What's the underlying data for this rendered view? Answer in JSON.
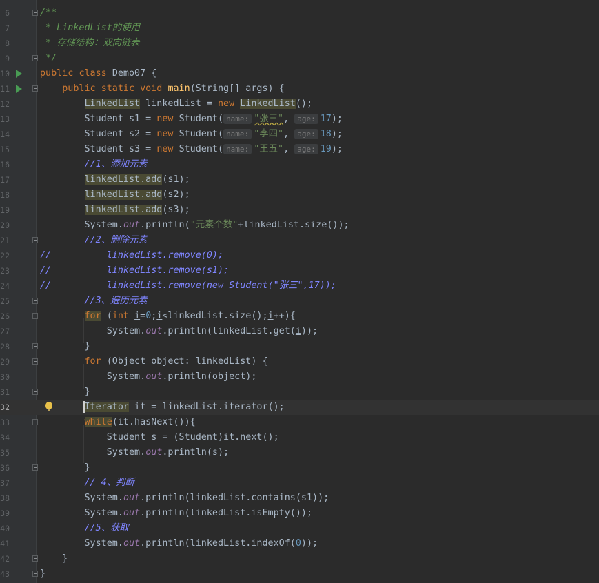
{
  "editor": {
    "lines": [
      {
        "n": "6",
        "segs": [
          {
            "t": "/**",
            "c": "cm"
          }
        ]
      },
      {
        "n": "7",
        "segs": [
          {
            "t": " * LinkedList的使用",
            "c": "cm"
          }
        ]
      },
      {
        "n": "8",
        "segs": [
          {
            "t": " * 存储结构：双向链表",
            "c": "cm"
          }
        ]
      },
      {
        "n": "9",
        "segs": [
          {
            "t": " */",
            "c": "cm"
          }
        ]
      },
      {
        "n": "10",
        "segs": [
          {
            "t": "public ",
            "c": "kw"
          },
          {
            "t": "class ",
            "c": "kw"
          },
          {
            "t": "Demo07 {"
          }
        ]
      },
      {
        "n": "11",
        "segs": [
          {
            "t": "    "
          },
          {
            "t": "public ",
            "c": "kw"
          },
          {
            "t": "static ",
            "c": "kw"
          },
          {
            "t": "void ",
            "c": "kw"
          },
          {
            "t": "main",
            "c": "fn"
          },
          {
            "t": "(String[] args) {"
          }
        ]
      },
      {
        "n": "12",
        "segs": [
          {
            "t": "        "
          },
          {
            "t": "LinkedList",
            "c": "hl"
          },
          {
            "t": " linkedList = "
          },
          {
            "t": "new ",
            "c": "kw"
          },
          {
            "t": "LinkedList",
            "c": "hl"
          },
          {
            "t": "();"
          }
        ]
      },
      {
        "n": "13",
        "segs": [
          {
            "t": "        Student s1 = "
          },
          {
            "t": "new ",
            "c": "kw"
          },
          {
            "t": "Student("
          },
          {
            "t": "name:",
            "c": "hint"
          },
          {
            "t": "\"张三\"",
            "c": "str squig"
          },
          {
            "t": ", "
          },
          {
            "t": "age:",
            "c": "hint"
          },
          {
            "t": "17",
            "c": "num"
          },
          {
            "t": ");"
          }
        ]
      },
      {
        "n": "14",
        "segs": [
          {
            "t": "        Student s2 = "
          },
          {
            "t": "new ",
            "c": "kw"
          },
          {
            "t": "Student("
          },
          {
            "t": "name:",
            "c": "hint"
          },
          {
            "t": "\"李四\"",
            "c": "str"
          },
          {
            "t": ", "
          },
          {
            "t": "age:",
            "c": "hint"
          },
          {
            "t": "18",
            "c": "num"
          },
          {
            "t": ");"
          }
        ]
      },
      {
        "n": "15",
        "segs": [
          {
            "t": "        Student s3 = "
          },
          {
            "t": "new ",
            "c": "kw"
          },
          {
            "t": "Student("
          },
          {
            "t": "name:",
            "c": "hint"
          },
          {
            "t": "\"王五\"",
            "c": "str"
          },
          {
            "t": ", "
          },
          {
            "t": "age:",
            "c": "hint"
          },
          {
            "t": "19",
            "c": "num"
          },
          {
            "t": ");"
          }
        ]
      },
      {
        "n": "16",
        "segs": [
          {
            "t": "        "
          },
          {
            "t": "//1、添加元素",
            "c": "cmb"
          }
        ]
      },
      {
        "n": "17",
        "segs": [
          {
            "t": "        "
          },
          {
            "t": "linkedList.add",
            "c": "hl"
          },
          {
            "t": "(s1);"
          }
        ]
      },
      {
        "n": "18",
        "segs": [
          {
            "t": "        "
          },
          {
            "t": "linkedList.add",
            "c": "hl"
          },
          {
            "t": "(s2);"
          }
        ]
      },
      {
        "n": "19",
        "segs": [
          {
            "t": "        "
          },
          {
            "t": "linkedList.add",
            "c": "hl"
          },
          {
            "t": "(s3);"
          }
        ]
      },
      {
        "n": "20",
        "segs": [
          {
            "t": "        System."
          },
          {
            "t": "out",
            "c": "field"
          },
          {
            "t": ".println("
          },
          {
            "t": "\"元素个数\"",
            "c": "str"
          },
          {
            "t": "+linkedList.size());"
          }
        ]
      },
      {
        "n": "21",
        "segs": [
          {
            "t": "        "
          },
          {
            "t": "//2、删除元素",
            "c": "cmb"
          }
        ]
      },
      {
        "n": "22",
        "segs": [
          {
            "t": "//",
            "c": "cmb"
          },
          {
            "t": "          linkedList.remove(0);",
            "c": "cmb"
          }
        ]
      },
      {
        "n": "23",
        "segs": [
          {
            "t": "//",
            "c": "cmb"
          },
          {
            "t": "          linkedList.remove(s1);",
            "c": "cmb"
          }
        ]
      },
      {
        "n": "24",
        "segs": [
          {
            "t": "//",
            "c": "cmb"
          },
          {
            "t": "          linkedList.remove(new Student(\"张三\",17));",
            "c": "cmb"
          }
        ]
      },
      {
        "n": "25",
        "segs": [
          {
            "t": "        "
          },
          {
            "t": "//3、遍历元素",
            "c": "cmb"
          }
        ]
      },
      {
        "n": "26",
        "segs": [
          {
            "t": "        "
          },
          {
            "t": "for",
            "c": "kw hl"
          },
          {
            "t": " ("
          },
          {
            "t": "int ",
            "c": "kw"
          },
          {
            "t": "i",
            "c": "ul"
          },
          {
            "t": "="
          },
          {
            "t": "0",
            "c": "num"
          },
          {
            "t": ";"
          },
          {
            "t": "i",
            "c": "ul"
          },
          {
            "t": "<linkedList.size();"
          },
          {
            "t": "i",
            "c": "ul"
          },
          {
            "t": "++){"
          }
        ]
      },
      {
        "n": "27",
        "segs": [
          {
            "t": "            System."
          },
          {
            "t": "out",
            "c": "field"
          },
          {
            "t": ".println(linkedList.get("
          },
          {
            "t": "i",
            "c": "ul"
          },
          {
            "t": "));"
          }
        ]
      },
      {
        "n": "28",
        "segs": [
          {
            "t": "        }"
          }
        ]
      },
      {
        "n": "29",
        "segs": [
          {
            "t": "        "
          },
          {
            "t": "for ",
            "c": "kw"
          },
          {
            "t": "(Object object: linkedList) {"
          }
        ]
      },
      {
        "n": "30",
        "segs": [
          {
            "t": "            System."
          },
          {
            "t": "out",
            "c": "field"
          },
          {
            "t": ".println(object);"
          }
        ]
      },
      {
        "n": "31",
        "segs": [
          {
            "t": "        }"
          }
        ]
      },
      {
        "n": "32",
        "segs": [
          {
            "t": "        "
          },
          {
            "t": "Iterator",
            "c": "hl"
          },
          {
            "t": " it = linkedList.iterator();"
          }
        ]
      },
      {
        "n": "33",
        "segs": [
          {
            "t": "        "
          },
          {
            "t": "while",
            "c": "kw hl"
          },
          {
            "t": "(it.hasNext()){"
          }
        ]
      },
      {
        "n": "34",
        "segs": [
          {
            "t": "            Student s = (Student)it.next();"
          }
        ]
      },
      {
        "n": "35",
        "segs": [
          {
            "t": "            System."
          },
          {
            "t": "out",
            "c": "field"
          },
          {
            "t": ".println(s);"
          }
        ]
      },
      {
        "n": "36",
        "segs": [
          {
            "t": "        }"
          }
        ]
      },
      {
        "n": "37",
        "segs": [
          {
            "t": "        "
          },
          {
            "t": "// 4、判断",
            "c": "cmb"
          }
        ]
      },
      {
        "n": "38",
        "segs": [
          {
            "t": "        System."
          },
          {
            "t": "out",
            "c": "field"
          },
          {
            "t": ".println(linkedList.contains(s1));"
          }
        ]
      },
      {
        "n": "39",
        "segs": [
          {
            "t": "        System."
          },
          {
            "t": "out",
            "c": "field"
          },
          {
            "t": ".println(linkedList.isEmpty());"
          }
        ]
      },
      {
        "n": "40",
        "segs": [
          {
            "t": "        "
          },
          {
            "t": "//5、获取",
            "c": "cmb"
          }
        ]
      },
      {
        "n": "41",
        "segs": [
          {
            "t": "        System."
          },
          {
            "t": "out",
            "c": "field"
          },
          {
            "t": ".println(linkedList.indexOf("
          },
          {
            "t": "0",
            "c": "num"
          },
          {
            "t": "));"
          }
        ]
      },
      {
        "n": "42",
        "segs": [
          {
            "t": "    }"
          }
        ]
      },
      {
        "n": "43",
        "segs": [
          {
            "t": "}"
          }
        ]
      }
    ],
    "current_line": "32",
    "run_lines": [
      "10",
      "11"
    ],
    "bulb_line": "32",
    "fold_lines": [
      "6",
      "9",
      "11",
      "21",
      "25",
      "26",
      "28",
      "29",
      "31",
      "33",
      "36",
      "42",
      "43"
    ]
  }
}
